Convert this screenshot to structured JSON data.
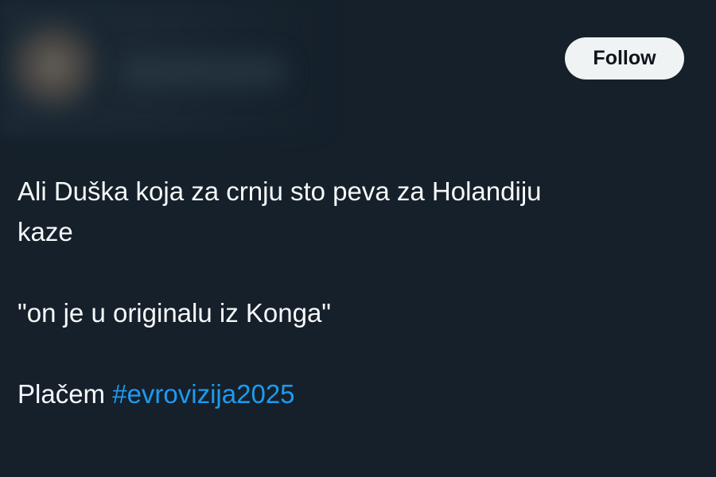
{
  "header": {
    "follow_label": "Follow"
  },
  "tweet": {
    "line1": "Ali Duška koja za crnju sto peva za Holandiju",
    "line2": "kaze",
    "line3": "\"on je u originalu iz Konga\"",
    "line4_text": "Plačem",
    "hashtag": "#evrovizija2025"
  },
  "colors": {
    "background": "#15202b",
    "text": "#f7f9f9",
    "link": "#1d9bf0",
    "follow_bg": "#eff3f4",
    "follow_text": "#0f1419"
  }
}
